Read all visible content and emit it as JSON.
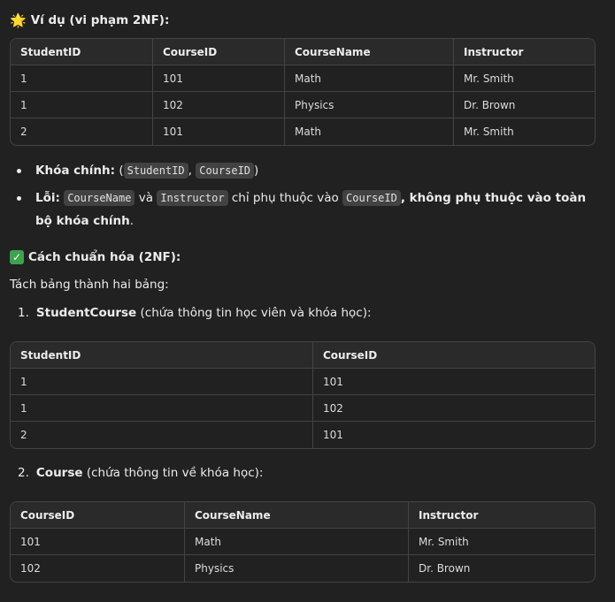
{
  "example_heading": {
    "icon": "star-icon",
    "text": "Ví dụ (vi phạm 2NF):"
  },
  "table1": {
    "headers": [
      "StudentID",
      "CourseID",
      "CourseName",
      "Instructor"
    ],
    "rows": [
      [
        "1",
        "101",
        "Math",
        "Mr. Smith"
      ],
      [
        "1",
        "102",
        "Physics",
        "Dr. Brown"
      ],
      [
        "2",
        "101",
        "Math",
        "Mr. Smith"
      ]
    ]
  },
  "bullet1": {
    "label": "Khóa chính:",
    "open": " (",
    "code1": "StudentID",
    "sep": ", ",
    "code2": "CourseID",
    "close": ")"
  },
  "bullet2": {
    "label": "Lỗi:",
    "code1": "CourseName",
    "and": " và ",
    "code2": "Instructor",
    "mid": " chỉ phụ thuộc vào ",
    "code3": "CourseID",
    "bold_tail": ", không phụ thuộc vào toàn bộ khóa chính",
    "end": "."
  },
  "solution_heading": {
    "icon": "check-icon",
    "text": "Cách chuẩn hóa (2NF):"
  },
  "split_text": "Tách bảng thành hai bảng:",
  "step1": {
    "num": "1.",
    "title": "StudentCourse",
    "desc": " (chứa thông tin học viên và khóa học):"
  },
  "table2": {
    "headers": [
      "StudentID",
      "CourseID"
    ],
    "rows": [
      [
        "1",
        "101"
      ],
      [
        "1",
        "102"
      ],
      [
        "2",
        "101"
      ]
    ]
  },
  "step2": {
    "num": "2.",
    "title": "Course",
    "desc": " (chứa thông tin về khóa học):"
  },
  "table3": {
    "headers": [
      "CourseID",
      "CourseName",
      "Instructor"
    ],
    "rows": [
      [
        "101",
        "Math",
        "Mr. Smith"
      ],
      [
        "102",
        "Physics",
        "Dr. Brown"
      ]
    ]
  }
}
